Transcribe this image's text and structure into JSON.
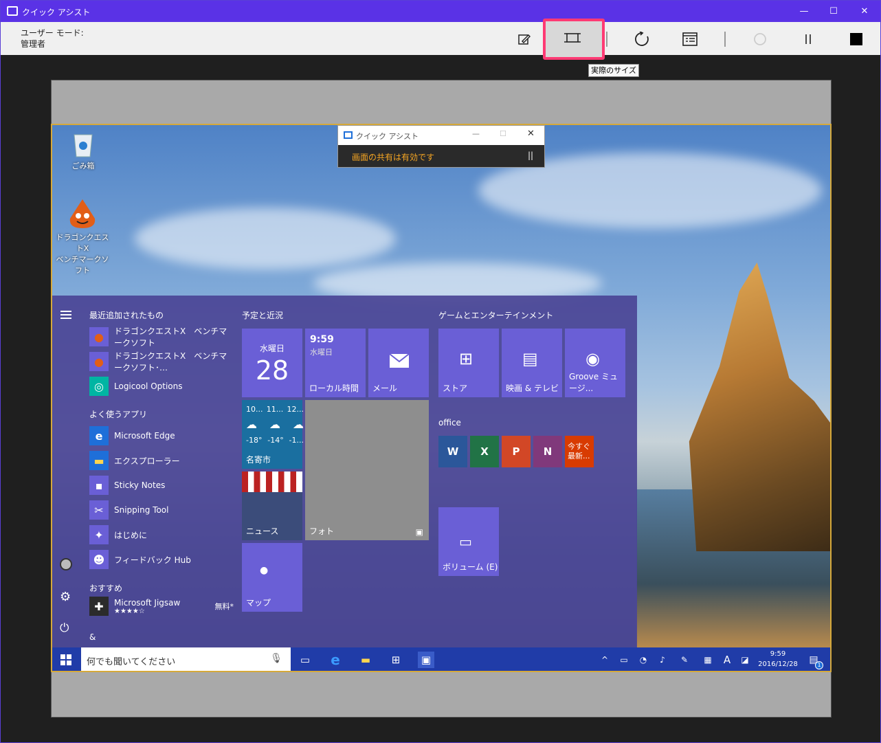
{
  "window": {
    "title": "クイック アシスト",
    "minimize": "—",
    "maximize": "☐",
    "close": "✕"
  },
  "toolbar": {
    "mode_label": "ユーザー モード:",
    "mode_value": "管理者",
    "tooltip": "実際のサイズ"
  },
  "desktop": {
    "icons": [
      {
        "label": "ごみ箱",
        "icon": "recycle-bin-icon"
      },
      {
        "label": "ドラゴンクエストⅩ",
        "label2": "ベンチマークソフト",
        "icon": "slime-icon"
      }
    ],
    "qa_mini": {
      "title": "クイック アシスト",
      "status": "画面の共有は有効です",
      "pause": "||"
    },
    "start": {
      "recent_title": "最近追加されたもの",
      "recent": [
        "ドラゴンクエストⅩ　ベンチマークソフト",
        "ドラゴンクエストⅩ　ベンチマークソフト･…",
        "Logicool Options"
      ],
      "frequent_title": "よく使うアプリ",
      "frequent": [
        "Microsoft Edge",
        "エクスプローラー",
        "Sticky Notes",
        "Snipping Tool",
        "はじめに",
        "フィードバック Hub"
      ],
      "recommended_title": "おすすめ",
      "recommended": {
        "name": "Microsoft Jigsaw",
        "price": "無料*",
        "stars": "★★★★☆"
      },
      "amp": "&",
      "group1_title": "予定と近況",
      "calendar": {
        "day": "水曜日",
        "date": "28"
      },
      "clock": {
        "time": "9:59",
        "day": "水曜日",
        "label": "ローカル時間"
      },
      "mail": "メール",
      "weather": {
        "days": [
          "10...",
          "11...",
          "12..."
        ],
        "temps": [
          "-18°",
          "-14°",
          "-1..."
        ],
        "city": "名寄市"
      },
      "news": "ニュース",
      "photos": "フォト",
      "maps": "マップ",
      "group2_title": "ゲームとエンターテインメント",
      "store": "ストア",
      "movies": "映画 & テレビ",
      "groove": "Groove ミュージ...",
      "office_title": "office",
      "office_tiles": [
        {
          "letter": "W",
          "color": "#2b579a"
        },
        {
          "letter": "X",
          "color": "#217346"
        },
        {
          "letter": "P",
          "color": "#d24726"
        },
        {
          "letter": "N",
          "color": "#80397b"
        }
      ],
      "get_office": "今すぐ\n最新...",
      "volume": "ボリューム (E)"
    },
    "taskbar": {
      "search_placeholder": "何でも聞いてください",
      "time": "9:59",
      "date": "2016/12/28",
      "ime": "A",
      "notif_count": "1"
    }
  }
}
